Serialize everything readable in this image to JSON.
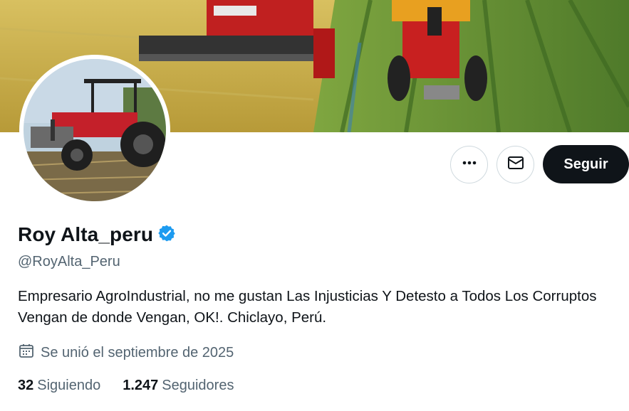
{
  "profile": {
    "display_name": "Roy Alta_peru",
    "handle": "@RoyAlta_Peru",
    "bio": "Empresario AgroIndustrial, no me gustan Las Injusticias Y Detesto a Todos Los Corruptos Vengan de donde Vengan, OK!. Chiclayo, Perú.",
    "joined": "Se unió el septiembre de 2025",
    "verified": true
  },
  "actions": {
    "more_icon": "more-horizontal-icon",
    "message_icon": "envelope-icon",
    "follow_label": "Seguir"
  },
  "stats": {
    "following_count": "32",
    "following_label": "Siguiendo",
    "followers_count": "1.247",
    "followers_label": "Seguidores"
  },
  "colors": {
    "verified_badge": "#1d9bf0",
    "follow_button_bg": "#0f1419",
    "secondary_text": "#536471"
  }
}
